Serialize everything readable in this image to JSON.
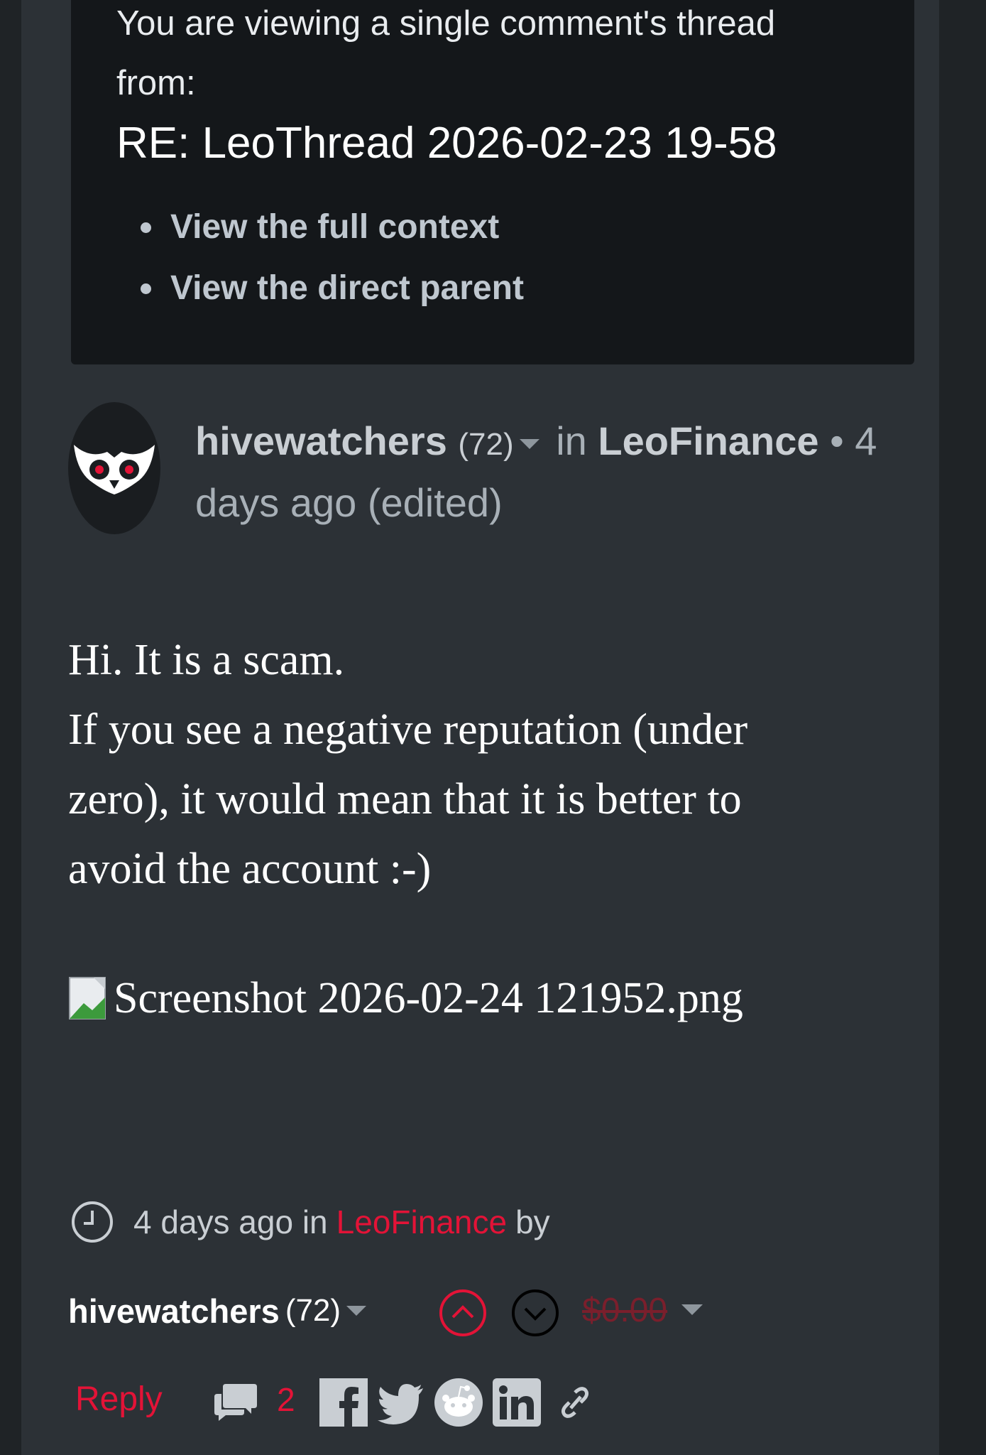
{
  "notice": {
    "line1": "You are viewing a single comment's thread",
    "line2": "from:",
    "title": "RE: LeoThread 2026-02-23 19-58",
    "links": [
      "View the full context",
      "View the direct parent"
    ]
  },
  "header": {
    "author": "hivewatchers",
    "reputation": "(72)",
    "in_text": "in",
    "community": "LeoFinance",
    "separator": "•",
    "time_part1": "4",
    "time_part2": "days ago (edited)"
  },
  "body": {
    "lines": [
      "Hi. It is a scam.",
      "If you see a negative reputation (under",
      "zero), it would mean that it is better to",
      "avoid the account :-)"
    ],
    "image_alt": "Screenshot 2026-02-24 121952.png"
  },
  "footer": {
    "time": "4 days ago in",
    "community": "LeoFinance",
    "by": "by",
    "author": "hivewatchers",
    "reputation": "(72)",
    "payout": "$0.00",
    "reply": "Reply",
    "comments_count": "2"
  },
  "icons": {
    "avatar": "owl-logo-icon",
    "clock": "clock-icon",
    "upvote": "chevron-up-circle-icon",
    "downvote": "chevron-down-circle-icon",
    "comments": "comments-icon",
    "share": [
      "facebook-icon",
      "twitter-icon",
      "reddit-icon",
      "linkedin-icon",
      "link-icon"
    ]
  },
  "colors": {
    "accent": "#e31337",
    "background": "#2c3136",
    "notice_bg": "#14171a"
  }
}
